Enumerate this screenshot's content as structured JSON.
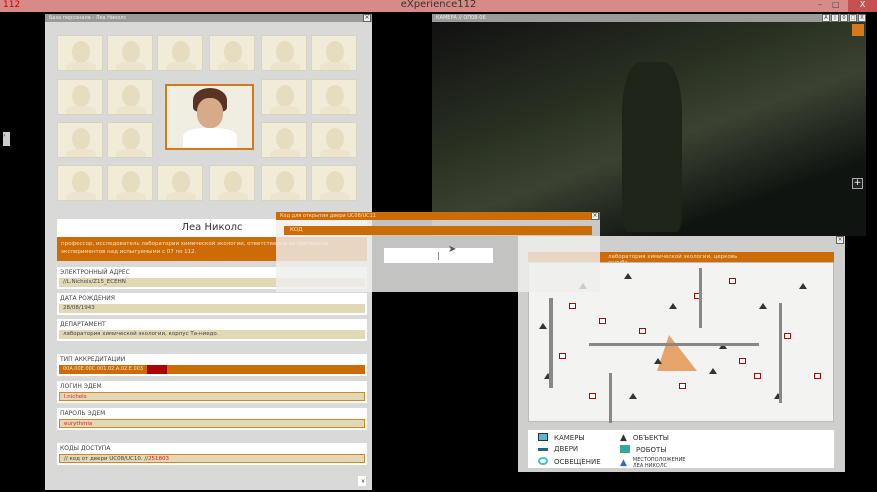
{
  "app": {
    "title": "eXperience112",
    "logo": "112",
    "minimize": "–",
    "maximize": "□",
    "close": "X"
  },
  "personnel": {
    "window_title": "База персонала - Леа Николс",
    "name": "Леа Николс",
    "description": "профессор, исследователь лаборатории химической экологии, ответственна за протоколы экспериментов над испытуемыми с 07 по 112.",
    "fields": [
      {
        "label": "ЭЛЕКТРОННЫЙ АДРЕС",
        "value": "//L.Nichols/Z15_ECEHN"
      },
      {
        "label": "ДАТА РОЖДЕНИЯ",
        "value": "28/08/1943"
      },
      {
        "label": "ДЕПАРТАМЕНТ",
        "value": "лаборатория химической экологии, корпус Та-ниедо."
      }
    ],
    "accreditation": {
      "label": "ТИП АККРЕДИТАЦИИ",
      "value": "00A.00E.00C.001.02.A.02.E.003",
      "level": 0.35
    },
    "login": {
      "label": "ЛОГИН ЭДЕМ",
      "value": "l.nichols"
    },
    "password": {
      "label": "ПАРОЛЬ ЭДЕМ",
      "value": "eurythmia"
    },
    "access_codes": {
      "label": "КОДЫ ДОСТУПА",
      "value": "// код от двери UC08/UC10. //",
      "code": "251803"
    },
    "scroll_down": "»"
  },
  "camera": {
    "window_title": "КАМЕРА // OП08-06",
    "buttons": [
      "A",
      "◊",
      "0",
      "□",
      "X"
    ],
    "zoom_in": "+"
  },
  "code_dialog": {
    "window_title": "Код для открытия двери UC08/UC11",
    "field_label": "КОД",
    "input_value": "|"
  },
  "map": {
    "header": "лаборатория химической экологии, церковь склуба",
    "legend": [
      {
        "icon": "camera-icon",
        "label": "КАМЕРЫ"
      },
      {
        "icon": "door-icon",
        "label": "ДВЕРИ"
      },
      {
        "icon": "light-icon",
        "label": "ОСВЕЩЕНИЕ"
      },
      {
        "icon": "object-icon",
        "label": "ОБЪЕКТЫ"
      },
      {
        "icon": "robot-icon",
        "label": "РОБОТЫ"
      },
      {
        "icon": "position-icon",
        "label": "МЕСТОПОЛОЖЕНИЕ ЛЕА НИКОЛС"
      }
    ]
  },
  "colors": {
    "accent": "#cd6c06",
    "titlebar": "#d88a86",
    "field": "#e2d8b6",
    "alert": "#aa0000"
  }
}
